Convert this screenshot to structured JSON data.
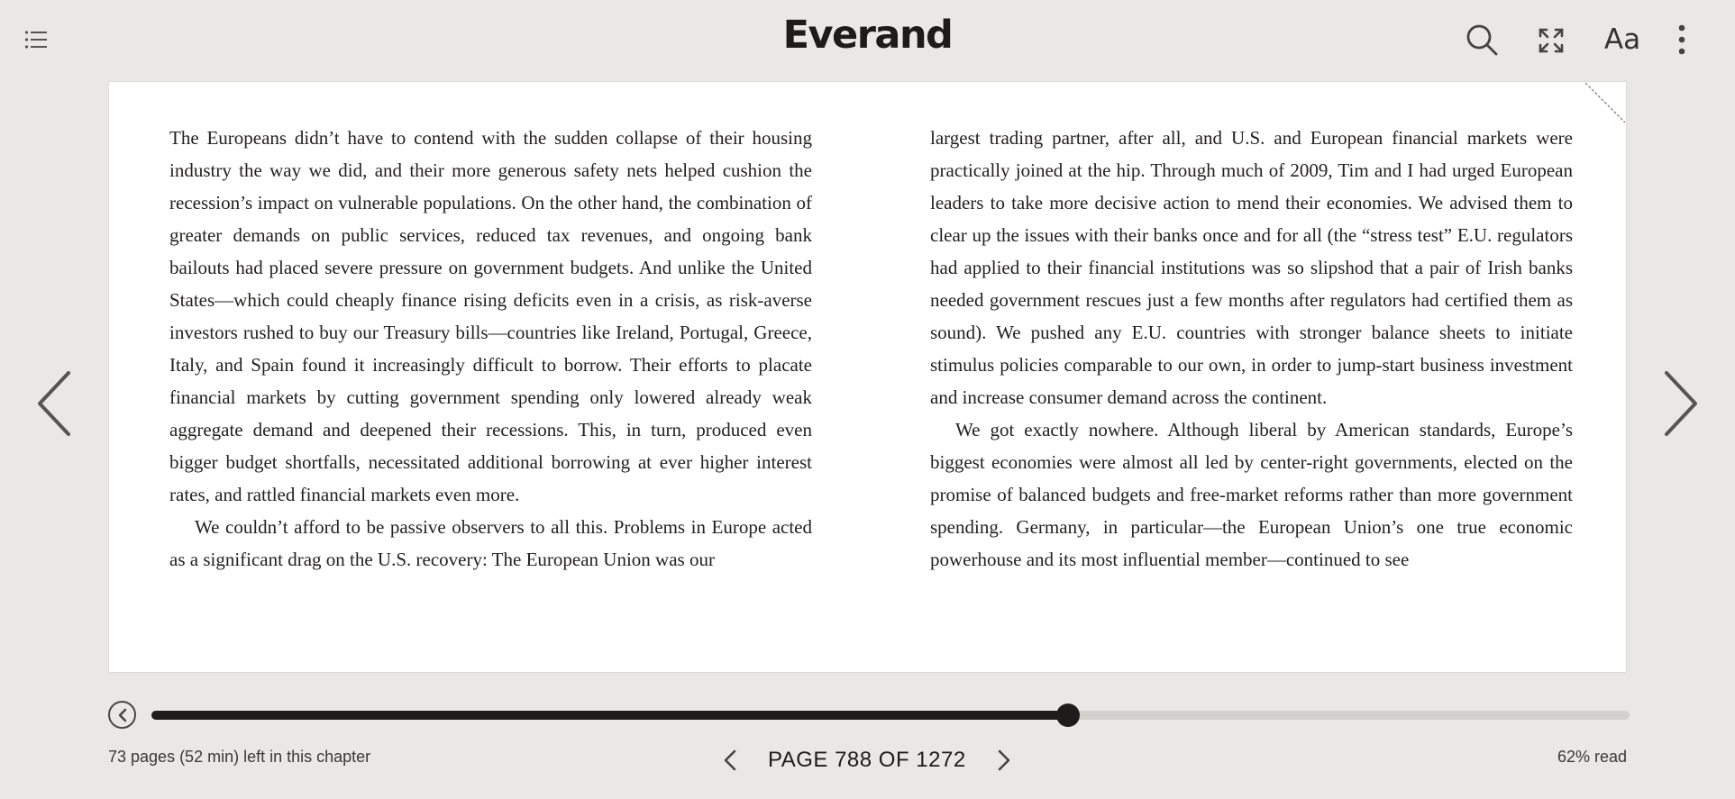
{
  "header": {
    "brand": "Everand",
    "font_button_label": "Aa"
  },
  "reader": {
    "left_column": [
      {
        "text": "The Europeans didn’t have to contend with the sudden collapse of their hous­ing industry the way we did, and their more generous safety nets helped cush­ion the recession’s impact on vulnerable populations. On the other hand, the combination of greater demands on public services, reduced tax revenues, and ongoing bank bailouts had placed severe pressure on government budgets. And unlike the United States—which could cheaply finance rising deficits even in a crisis, as risk-averse investors rushed to buy our Treasury bills—countries like Ireland, Portugal, Greece, Italy, and Spain found it increasingly difficult to borrow. Their efforts to placate financial markets by cutting government spend­ing only lowered already weak aggregate demand and deepened their reces­sions. This, in turn, produced even bigger budget shortfalls, necessitated addi­tional borrowing at ever higher interest rates, and rattled financial markets even more."
      },
      {
        "text": "We couldn’t afford to be passive observers to all this. Problems in Europe acted as a significant drag on the U.S. recovery: The European Union was our"
      }
    ],
    "right_column": [
      {
        "text": "largest trading partner, after all, and U.S. and European financial markets were practically joined at the hip. Through much of 2009, Tim and I had urged Euro­pean leaders to take more decisive action to mend their economies. We ad­vised them to clear up the issues with their banks once and for all (the “stress test” E.U. regulators had applied to their financial institutions was so slipshod that a pair of Irish banks needed government rescues just a few months after regulators had certified them as sound). We pushed any E.U. countries with stronger balance sheets to initiate stimulus policies comparable to our own, in order to jump-start business investment and increase consumer demand across the continent."
      },
      {
        "text": "We got exactly nowhere. Although liberal by American standards, Europe’s biggest economies were almost all led by center-right governments, elected on the promise of balanced budgets and free-market reforms rather than more government spending. Germany, in particular—the European Union’s one true economic powerhouse and its most influential member—continued to see"
      }
    ]
  },
  "progress": {
    "fraction_read": 0.62,
    "chapter_remaining": "73 pages (52 min) left in this chapter",
    "page_indicator": "PAGE 788 OF 1272",
    "percent_read_label": "62% read"
  },
  "icons": [
    "list-icon",
    "search-icon",
    "fullscreen-icon",
    "more-vertical-icon",
    "chevron-left-icon",
    "chevron-right-icon",
    "back-circle-icon"
  ]
}
